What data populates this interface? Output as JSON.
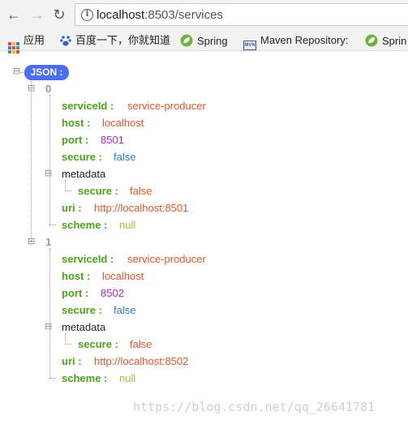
{
  "browser": {
    "url_host": "localhost",
    "url_path": ":8503/services",
    "bookmarks": [
      {
        "label": "应用",
        "icon": "apps-grid-icon"
      },
      {
        "label": "百度一下，你就知道",
        "icon": "baidu-paw-icon"
      },
      {
        "label": "Spring",
        "icon": "spring-leaf-icon"
      },
      {
        "label": "Maven Repository:",
        "icon": "mvn-icon"
      },
      {
        "label": "Sprin",
        "icon": "spring-leaf-icon"
      }
    ],
    "mvn_icon_text": "MVN"
  },
  "json_viewer": {
    "root_label": "JSON :",
    "items": [
      {
        "index": "0",
        "serviceId_key": "serviceId :",
        "serviceId": "service-producer",
        "host_key": "host :",
        "host": "localhost",
        "port_key": "port :",
        "port": "8501",
        "secure_key": "secure :",
        "secure": "false",
        "metadata_key": "metadata",
        "metadata_secure_key": "secure :",
        "metadata_secure": "false",
        "uri_key": "uri :",
        "uri": "http://localhost:8501",
        "scheme_key": "scheme :",
        "scheme": "null"
      },
      {
        "index": "1",
        "serviceId_key": "serviceId :",
        "serviceId": "service-producer",
        "host_key": "host :",
        "host": "localhost",
        "port_key": "port :",
        "port": "8502",
        "secure_key": "secure :",
        "secure": "false",
        "metadata_key": "metadata",
        "metadata_secure_key": "secure :",
        "metadata_secure": "false",
        "uri_key": "uri :",
        "uri": "http://localhost:8502",
        "scheme_key": "scheme :",
        "scheme": "null"
      }
    ]
  },
  "watermark": "https://blog.csdn.net/qq_26641781",
  "colors": {
    "badge": "#4a6cf7",
    "key": "#4aa319",
    "string": "#e2572c",
    "number": "#b025c9",
    "boolean": "#2f7fc2",
    "null": "#b8b23a"
  }
}
